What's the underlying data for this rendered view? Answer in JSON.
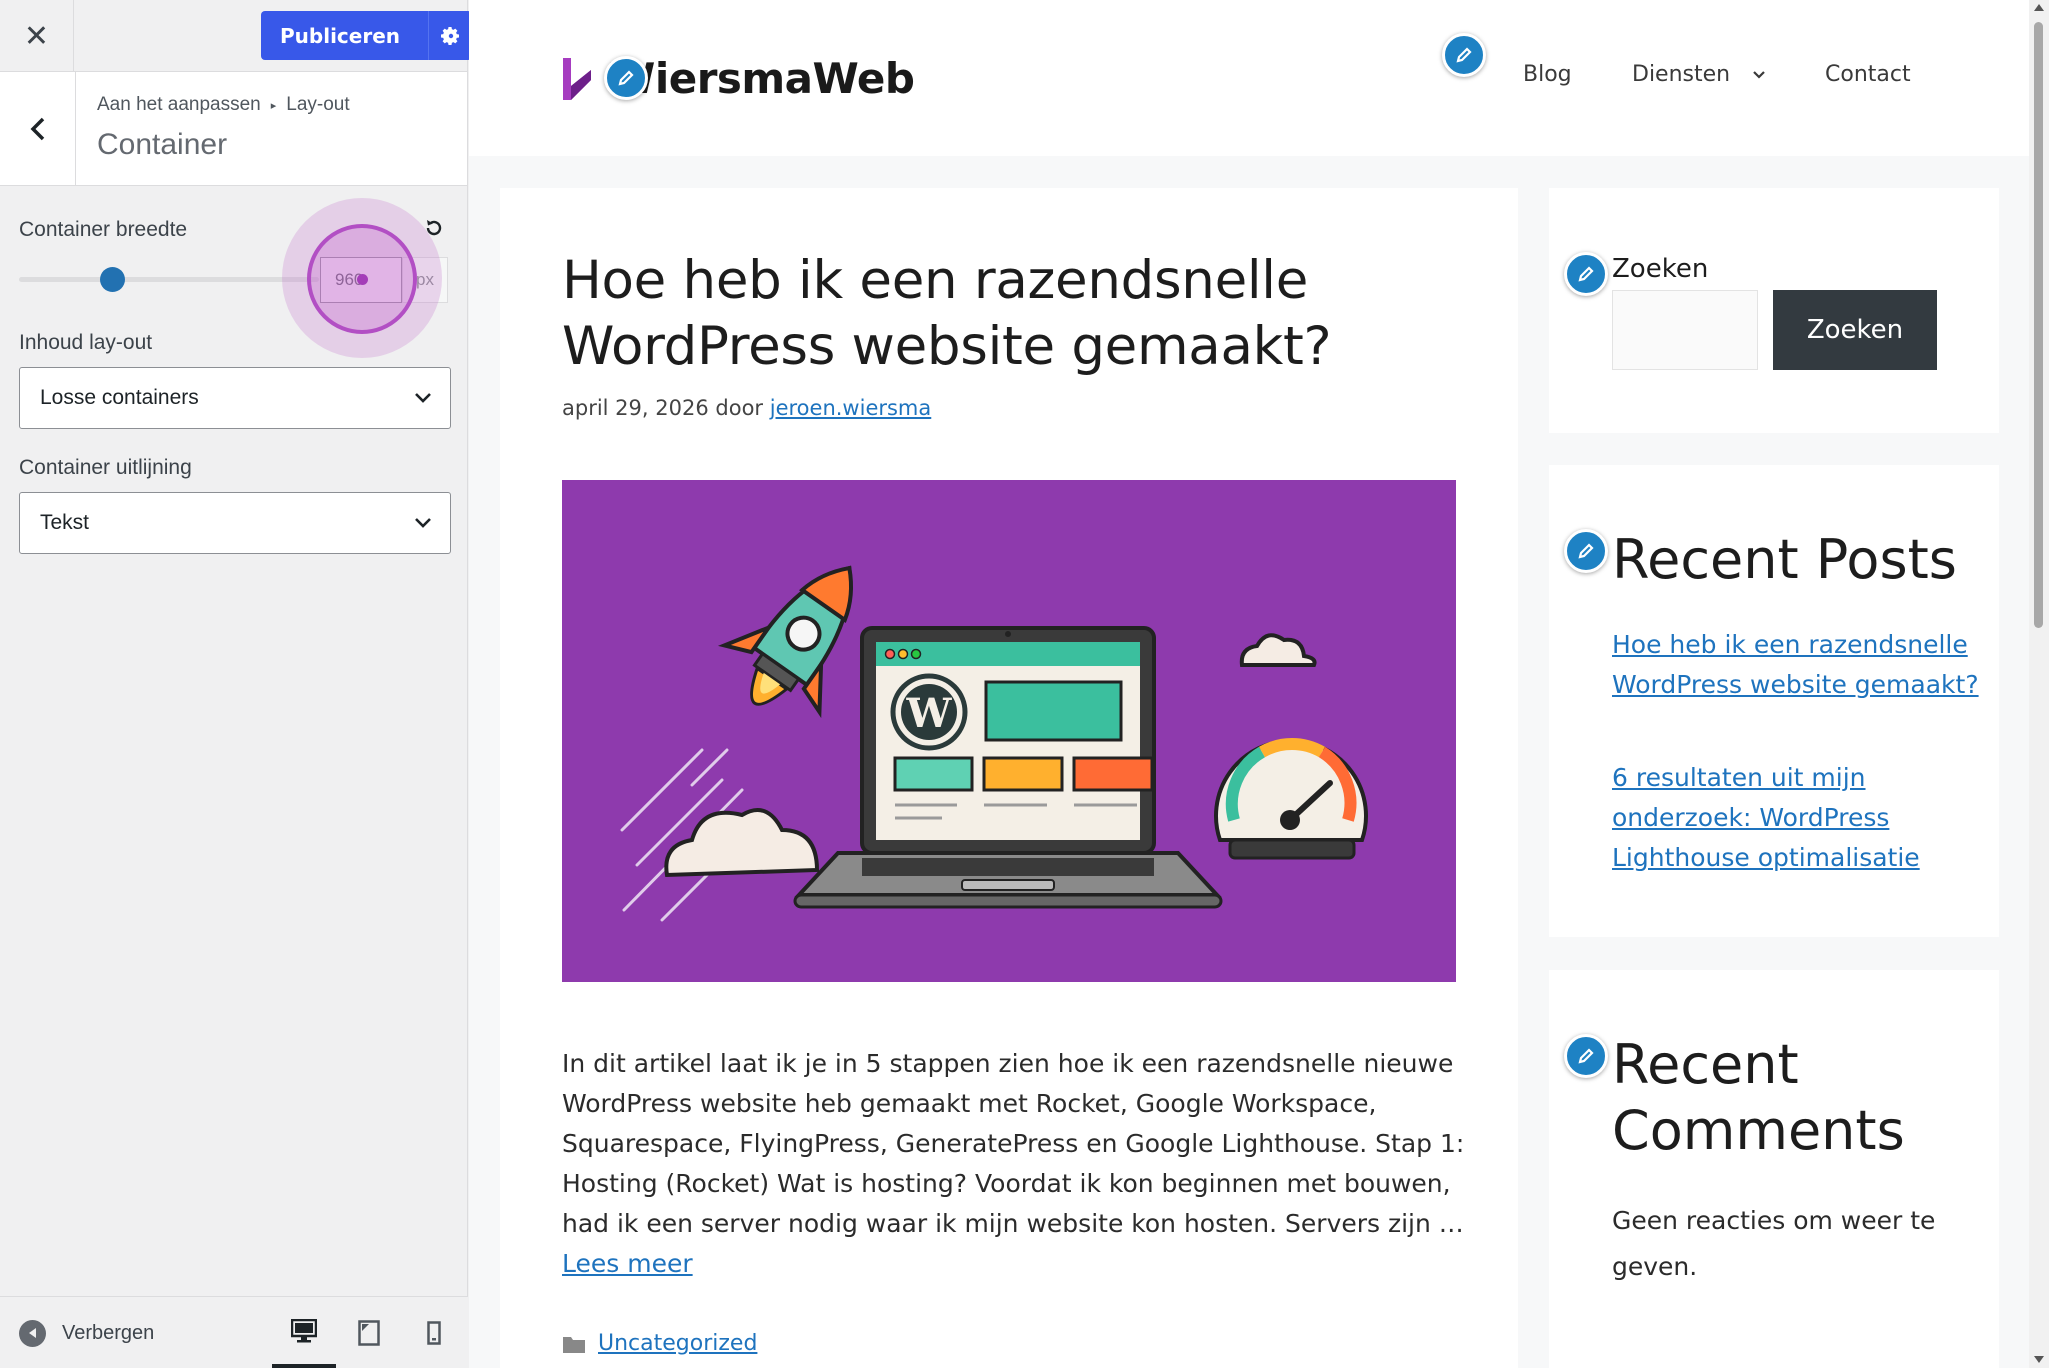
{
  "customizer": {
    "close_icon": "close-icon",
    "publish_label": "Publiceren",
    "publish_settings_icon": "gear-icon",
    "breadcrumb": {
      "root": "Aan het aanpassen",
      "parent": "Lay-out"
    },
    "section_title": "Container",
    "controls": {
      "container_width": {
        "label": "Container breedte",
        "value": "960",
        "unit": "px",
        "slider_fraction": 0.31
      },
      "content_layout": {
        "label": "Inhoud lay-out",
        "selected": "Losse containers"
      },
      "container_alignment": {
        "label": "Container uitlijning",
        "selected": "Tekst"
      }
    },
    "footer": {
      "hide_label": "Verbergen",
      "devices": [
        "desktop",
        "tablet",
        "mobile"
      ],
      "active_device": "desktop"
    },
    "accent": "#3858e9"
  },
  "preview": {
    "site": {
      "logo_text": "WiersmaWeb"
    },
    "nav": {
      "items": [
        "Blog",
        "Diensten",
        "Contact"
      ]
    },
    "post": {
      "title": "Hoe heb ik een razendsnelle WordPress website gemaakt?",
      "date": "april 29, 2026",
      "by": "door",
      "author": "jeroen.wiersma",
      "excerpt": "In dit artikel laat ik je in 5 stappen zien hoe ik een razendsnelle nieuwe WordPress website heb gemaakt met Rocket, Google Workspace, Squarespace, FlyingPress, GeneratePress en Google Lighthouse. Stap 1: Hosting (Rocket) Wat is hosting? Voordat ik kon beginnen met bouwen, had ik een server nodig waar ik mijn website kon hosten. Servers zijn …",
      "read_more": "Lees meer",
      "category": "Uncategorized"
    },
    "sidebar": {
      "search_label": "Zoeken",
      "search_button": "Zoeken",
      "recent_posts_title": "Recent Posts",
      "recent_posts": [
        "Hoe heb ik een razendsnelle WordPress website gemaakt?",
        "6 resultaten uit mijn onderzoek: WordPress Lighthouse optimalisatie"
      ],
      "recent_comments_title": "Recent Comments",
      "no_comments": "Geen reacties om weer te geven."
    },
    "edit_icon": "pencil-icon",
    "link_color": "#1e73be"
  }
}
